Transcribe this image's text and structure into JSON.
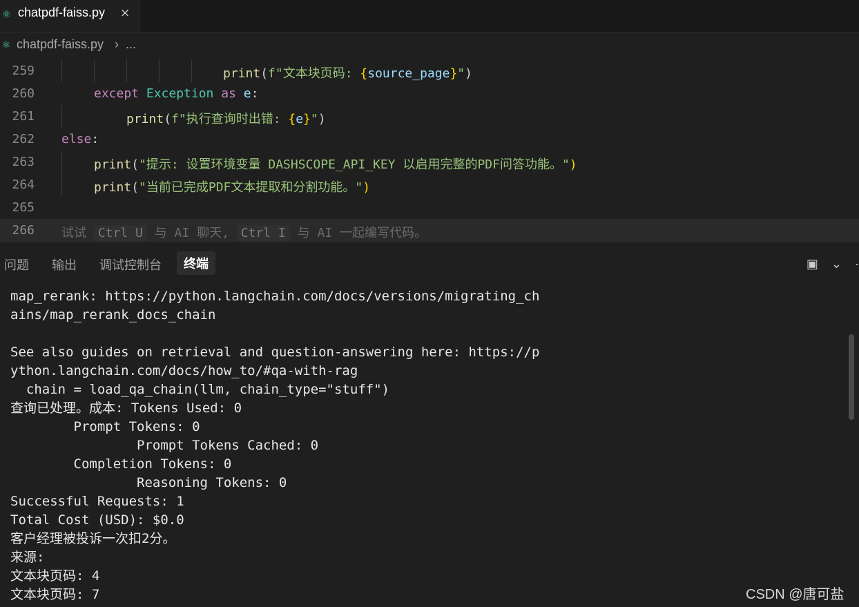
{
  "tab": {
    "icon": "python-icon",
    "filename": "chatpdf-faiss.py",
    "close": "×"
  },
  "breadcrumb": {
    "file": "chatpdf-faiss.py",
    "separator": "›",
    "more": "..."
  },
  "editor": {
    "lines": [
      {
        "number": "259",
        "parts": [
          {
            "t": "print",
            "c": "fn"
          },
          {
            "t": "(",
            "c": "punc"
          },
          {
            "t": "f",
            "c": "str"
          },
          {
            "t": "\"文本块页码: ",
            "c": "str"
          },
          {
            "t": "{",
            "c": "brace"
          },
          {
            "t": "source_page",
            "c": "ident"
          },
          {
            "t": "}",
            "c": "brace"
          },
          {
            "t": "\"",
            "c": "str"
          },
          {
            "t": ")",
            "c": "punc"
          }
        ]
      },
      {
        "number": "260",
        "parts": [
          {
            "t": "except ",
            "c": "kw"
          },
          {
            "t": "Exception ",
            "c": "cls"
          },
          {
            "t": "as ",
            "c": "kw"
          },
          {
            "t": "e",
            "c": "ident"
          },
          {
            "t": ":",
            "c": "punc"
          }
        ]
      },
      {
        "number": "261",
        "parts": [
          {
            "t": "print",
            "c": "fn"
          },
          {
            "t": "(",
            "c": "punc"
          },
          {
            "t": "f",
            "c": "str"
          },
          {
            "t": "\"执行查询时出错: ",
            "c": "str"
          },
          {
            "t": "{",
            "c": "brace"
          },
          {
            "t": "e",
            "c": "ident"
          },
          {
            "t": "}",
            "c": "brace"
          },
          {
            "t": "\"",
            "c": "str"
          },
          {
            "t": ")",
            "c": "punc"
          }
        ]
      },
      {
        "number": "262",
        "parts": [
          {
            "t": "else",
            "c": "kw"
          },
          {
            "t": ":",
            "c": "punc"
          }
        ]
      },
      {
        "number": "263",
        "parts": [
          {
            "t": "print",
            "c": "fn"
          },
          {
            "t": "(",
            "c": "punc"
          },
          {
            "t": "\"提示: 设置环境变量 DASHSCOPE_API_KEY 以启用完整的PDF问答功能。\"",
            "c": "str"
          },
          {
            "t": ")",
            "c": "brace"
          }
        ]
      },
      {
        "number": "264",
        "parts": [
          {
            "t": "print",
            "c": "fn"
          },
          {
            "t": "(",
            "c": "punc"
          },
          {
            "t": "\"当前已完成PDF文本提取和分割功能。\"",
            "c": "str"
          },
          {
            "t": ")",
            "c": "brace"
          }
        ]
      },
      {
        "number": "265",
        "parts": []
      },
      {
        "number": "266",
        "parts": []
      }
    ],
    "hint": {
      "text1": "试试",
      "key1": "Ctrl U",
      "text2": "与 AI 聊天,",
      "key2": "Ctrl I",
      "text3": "与 AI 一起编写代码。"
    }
  },
  "panel": {
    "tabs": [
      "问题",
      "输出",
      "调试控制台",
      "终端"
    ],
    "active_tab": "终端",
    "icons": [
      "split-panel-icon",
      "chevron-down-icon",
      "more-icon"
    ]
  },
  "terminal": {
    "lines": [
      "map_rerank: https://python.langchain.com/docs/versions/migrating_ch",
      "ains/map_rerank_docs_chain",
      "",
      "See also guides on retrieval and question-answering here: https://p",
      "ython.langchain.com/docs/how_to/#qa-with-rag",
      "  chain = load_qa_chain(llm, chain_type=\"stuff\")",
      "查询已处理。成本: Tokens Used: 0",
      "        Prompt Tokens: 0",
      "                Prompt Tokens Cached: 0",
      "        Completion Tokens: 0",
      "                Reasoning Tokens: 0",
      "Successful Requests: 1",
      "Total Cost (USD): $0.0",
      "客户经理被投诉一次扣2分。",
      "来源:",
      "文本块页码: 4",
      "文本块页码: 7"
    ]
  },
  "watermark": "CSDN @唐可盐"
}
